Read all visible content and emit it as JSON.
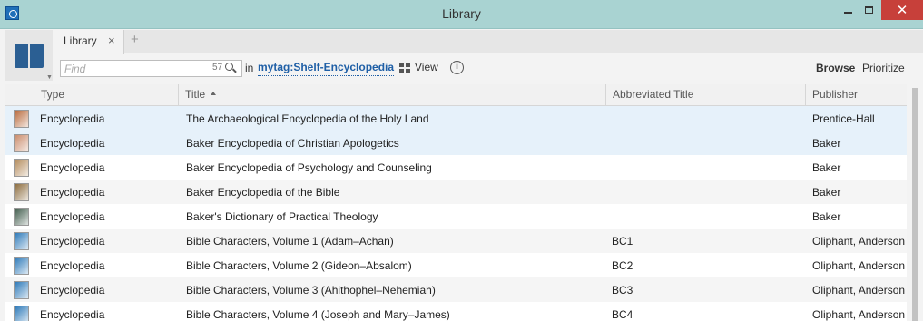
{
  "window": {
    "title": "Library"
  },
  "tabs": {
    "active_label": "Library",
    "close_glyph": "×",
    "new_tab_glyph": "+"
  },
  "search": {
    "placeholder": "Find",
    "count": "57"
  },
  "filter": {
    "in_label": "in",
    "tag": "mytag:Shelf-Encyclopedia"
  },
  "toolbar": {
    "view_label": "View",
    "browse_label": "Browse",
    "prioritize_label": "Prioritize"
  },
  "columns": {
    "type": "Type",
    "title": "Title",
    "abbreviated_title": "Abbreviated Title",
    "publisher": "Publisher",
    "sorted_by": "Title",
    "sort_direction": "ascending"
  },
  "rows": [
    {
      "type": "Encyclopedia",
      "title": "The Archaeological Encyclopedia of the Holy Land",
      "abbr": "",
      "publisher": "Prentice-Hall",
      "cover_color": "#b86a3c"
    },
    {
      "type": "Encyclopedia",
      "title": "Baker Encyclopedia of Christian Apologetics",
      "abbr": "",
      "publisher": "Baker",
      "cover_color": "#c98a6a"
    },
    {
      "type": "Encyclopedia",
      "title": "Baker Encyclopedia of Psychology and Counseling",
      "abbr": "",
      "publisher": "Baker",
      "cover_color": "#b38a5a"
    },
    {
      "type": "Encyclopedia",
      "title": "Baker Encyclopedia of the Bible",
      "abbr": "",
      "publisher": "Baker",
      "cover_color": "#8a6a3a"
    },
    {
      "type": "Encyclopedia",
      "title": "Baker's Dictionary of Practical Theology",
      "abbr": "",
      "publisher": "Baker",
      "cover_color": "#3e5a4a"
    },
    {
      "type": "Encyclopedia",
      "title": "Bible Characters, Volume 1 (Adam–Achan)",
      "abbr": "BC1",
      "publisher": "Oliphant, Anderson",
      "cover_color": "#2b78b8"
    },
    {
      "type": "Encyclopedia",
      "title": "Bible Characters, Volume 2 (Gideon–Absalom)",
      "abbr": "BC2",
      "publisher": "Oliphant, Anderson",
      "cover_color": "#2b78b8"
    },
    {
      "type": "Encyclopedia",
      "title": "Bible Characters, Volume 3 (Ahithophel–Nehemiah)",
      "abbr": "BC3",
      "publisher": "Oliphant, Anderson",
      "cover_color": "#2b78b8"
    },
    {
      "type": "Encyclopedia",
      "title": "Bible Characters, Volume 4 (Joseph and Mary–James)",
      "abbr": "BC4",
      "publisher": "Oliphant, Anderson",
      "cover_color": "#2b78b8"
    }
  ],
  "colors": {
    "titlebar": "#a9d3d2",
    "link": "#1f5fa6",
    "selected_row": "#e6f1fa",
    "close_button": "#c7403a"
  }
}
